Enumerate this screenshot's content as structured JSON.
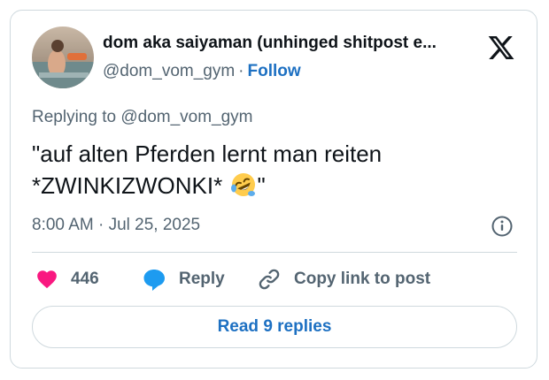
{
  "author": {
    "display_name": "dom aka saiyaman (unhinged shitpost e...",
    "handle": "@dom_vom_gym",
    "separator": "·",
    "follow_label": "Follow"
  },
  "tweet": {
    "replying_to": "Replying to @dom_vom_gym",
    "text_line1": "\"auf alten Pferden lernt man reiten",
    "text_line2_before_emoji": "*ZWINKIZWONKI* ",
    "text_line2_after_emoji": "\"",
    "emoji": "rolling-on-floor-laughing-emoji",
    "timestamp": "8:00 AM · Jul 25, 2025"
  },
  "actions": {
    "like_count": "446",
    "reply_label": "Reply",
    "copy_link_label": "Copy link to post"
  },
  "footer": {
    "read_replies_label": "Read 9 replies"
  },
  "icons": {
    "logo": "x-logo-icon",
    "info": "info-icon",
    "heart": "heart-icon",
    "reply": "reply-bubble-icon",
    "link": "link-icon"
  },
  "colors": {
    "heart": "#f91880",
    "reply_bubble": "#1d9bf0",
    "link_blue": "#1d70c2",
    "secondary_text": "#536471",
    "primary_text": "#0f1419",
    "border": "#cfd9de"
  }
}
